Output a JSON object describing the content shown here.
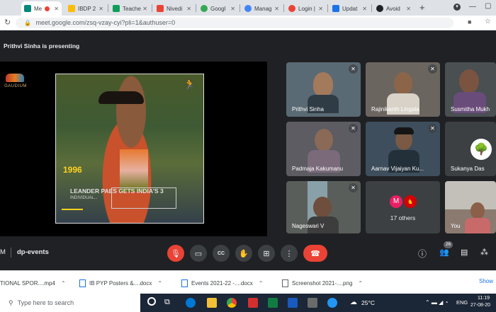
{
  "browser": {
    "tabs": [
      {
        "label": "Me",
        "favicon_color": "#00897b",
        "active": true
      },
      {
        "label": "IBDP 2",
        "favicon_color": "#fbbc04"
      },
      {
        "label": "Teache",
        "favicon_color": "#0f9d58"
      },
      {
        "label": "Nivedi",
        "favicon_color": "#ea4335"
      },
      {
        "label": "Googl",
        "favicon_color": "#34a853"
      },
      {
        "label": "Manag",
        "favicon_color": "#4285f4"
      },
      {
        "label": "Login |",
        "favicon_color": "#ea4335"
      },
      {
        "label": "Updat",
        "favicon_color": "#1a73e8"
      },
      {
        "label": "Avoid",
        "favicon_color": "#202124"
      }
    ],
    "new_tab": "+",
    "url": "meet.google.com/zsq-vzay-cyi?pli=1&authuser=0"
  },
  "meeting": {
    "presenting_label": "Prithvi Sinha is presenting",
    "meeting_code": "dp-events",
    "clock_fragment": "M",
    "participant_count": "26",
    "slide": {
      "year": "1996",
      "headline": "LEANDER PAES GETS INDIA'S 3",
      "sub": "INDIVIDUAL...",
      "logo_text": "GAUDIUM"
    },
    "participants": [
      {
        "name": "Prithvi Sinha",
        "bg": "#5a6a74",
        "muted": true
      },
      {
        "name": "Rajinikanth Lingala",
        "bg": "#6b6560",
        "muted": true
      },
      {
        "name": "Susmitha Mukh",
        "bg": "#4a4f52",
        "muted": false
      },
      {
        "name": "Padmaja Kakumanu",
        "bg": "#5c5c62",
        "muted": true
      },
      {
        "name": "Aarnav Vijaiyan Ku...",
        "bg": "#3e4e5c",
        "muted": true
      },
      {
        "name": "Sukanya Das",
        "bg": "#3c4043",
        "muted": false
      },
      {
        "name": "Nageswari V",
        "bg": "#5a5e5a",
        "muted": true
      },
      {
        "name": "17 others",
        "bg": "#3c4043",
        "muted": false
      },
      {
        "name": "You",
        "bg": "#8a7a70",
        "muted": false
      }
    ],
    "others_avatar_letter": "M"
  },
  "downloads": [
    {
      "label": "TIONAL SPOR....mp4"
    },
    {
      "label": "IB PYP Posters &....docx"
    },
    {
      "label": "Events 2021-22 -....docx"
    },
    {
      "label": "Screenshot 2021-....png"
    }
  ],
  "downloads_show_all": "Show",
  "taskbar": {
    "search_placeholder": "Type here to search",
    "weather": "25°C",
    "language": "ENG",
    "time": "11:19",
    "date": "27-08-20"
  },
  "colors": {
    "end_call": "#ea4335",
    "mic_off": "#ea4335",
    "accent": "#1a73e8"
  }
}
